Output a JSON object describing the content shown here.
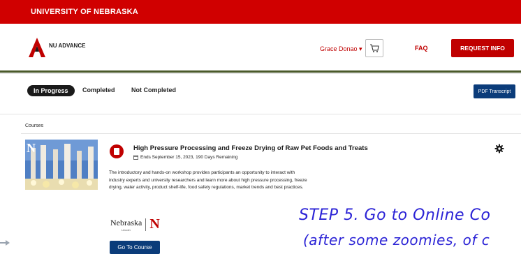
{
  "topbar": {
    "university": "UNIVERSITY OF NEBRASKA"
  },
  "header": {
    "brand": "NU ADVANCE",
    "user": "Grace Donao ▾",
    "faq": "FAQ",
    "request_info": "REQUEST INFO"
  },
  "tabs": {
    "in_progress": "In Progress",
    "completed": "Completed",
    "not_completed": "Not Completed",
    "pdf_transcript": "PDF Transcript"
  },
  "courses": {
    "section_label": "Courses",
    "item": {
      "title": "High Pressure Processing and Freeze Drying of Raw Pet Foods and Treats",
      "ends": "Ends September 15, 2023, 190 Days Remaining",
      "description": "The introductory and hands-on workshop provides participants an opportunity to interact with industry experts and university researchers and learn more about high pressure processing, freeze drying, water activity, product shelf-life, food safety regulations, market trends and best practices.",
      "partner_name": "Nebraska",
      "partner_sub": "Lincoln",
      "partner_mark": "N",
      "go_button": "Go To Course"
    }
  },
  "annotation": {
    "line1": "STEP 5. Go to Online Co",
    "line2": "(after some zoomies, of c"
  },
  "colors": {
    "brand_red": "#d00000",
    "navy": "#0b3c7a",
    "annotation_blue": "#2c24d6"
  }
}
